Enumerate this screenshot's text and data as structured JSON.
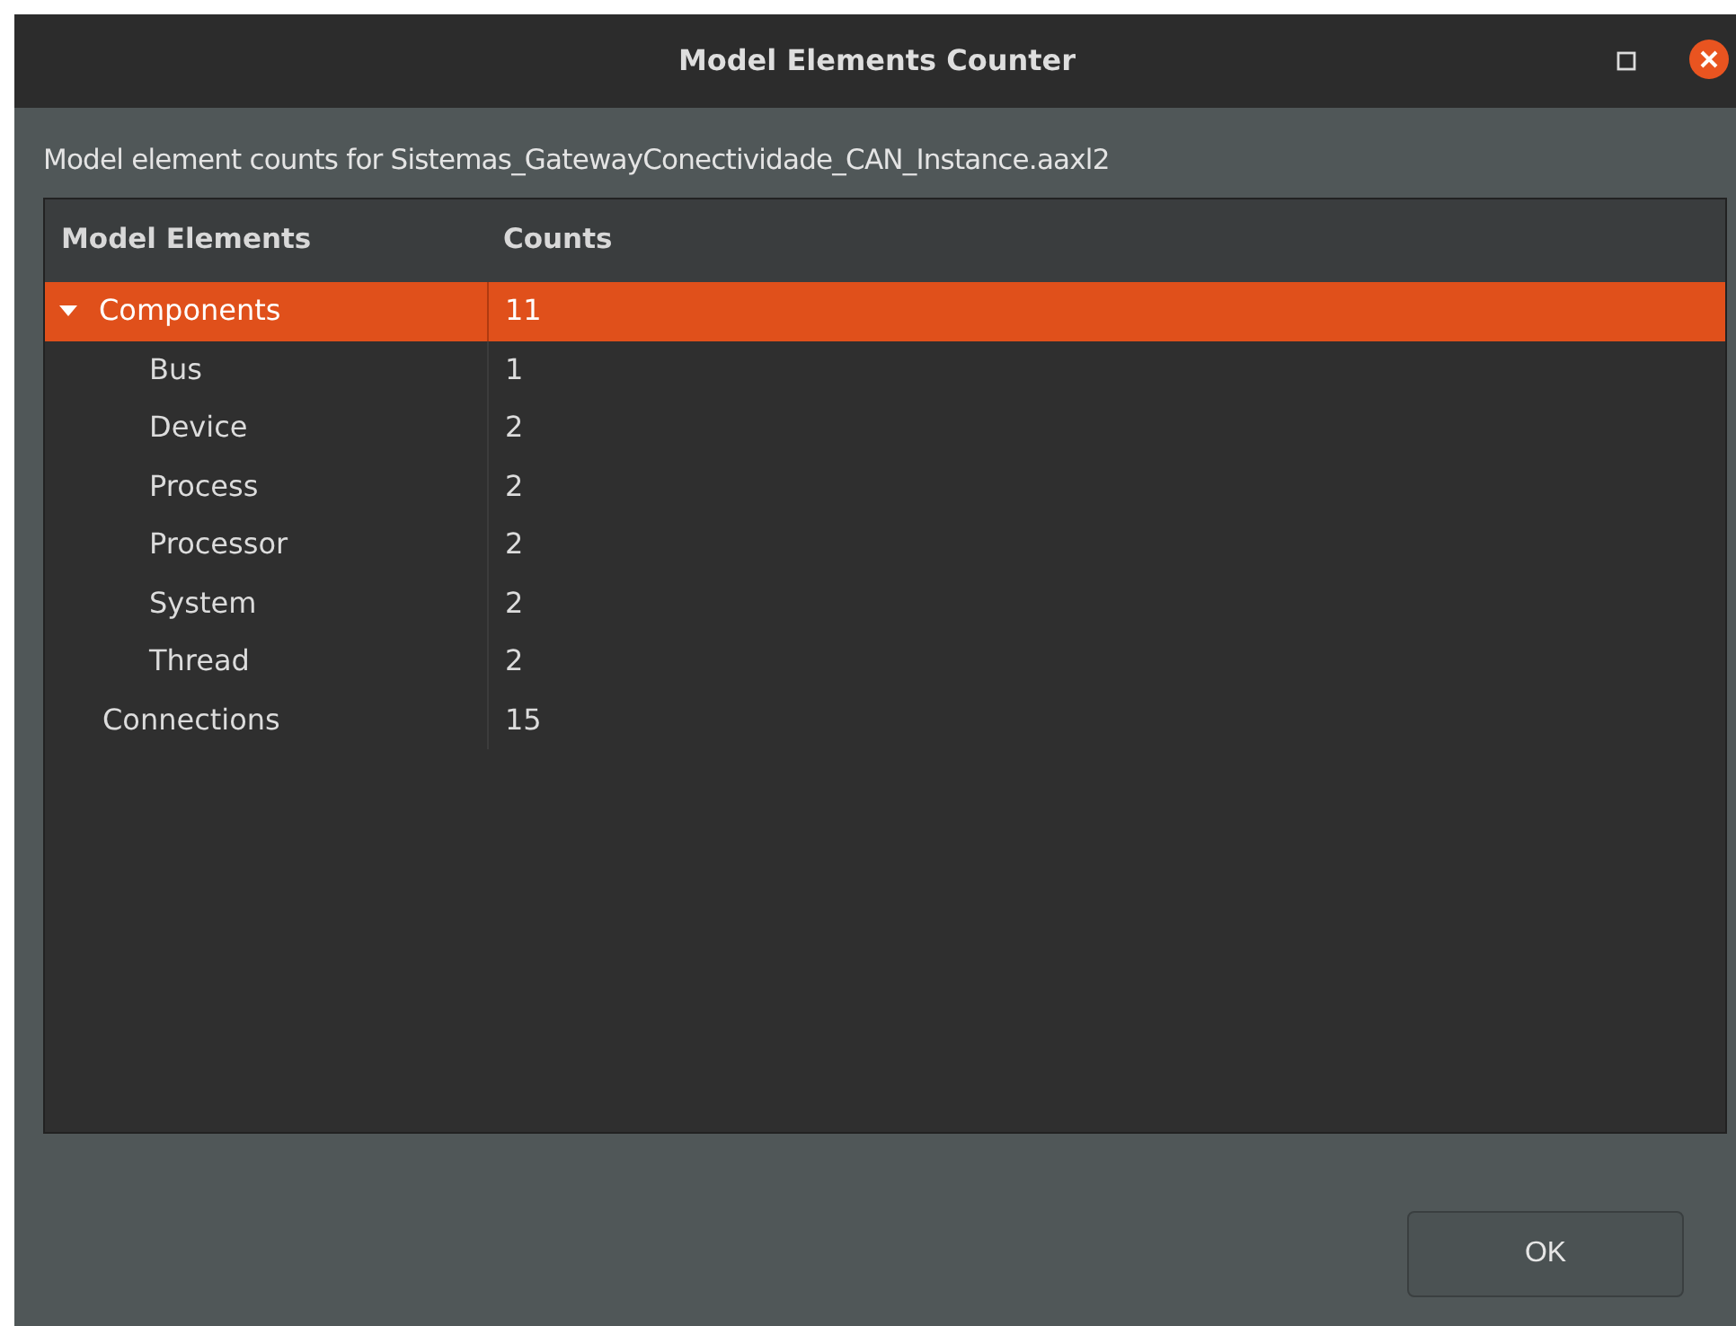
{
  "window": {
    "title": "Model Elements Counter"
  },
  "description": "Model element counts for Sistemas_GatewayConectividade_CAN_Instance.aaxl2",
  "table": {
    "columns": [
      "Model Elements",
      "Counts"
    ],
    "rows": [
      {
        "label": "Components",
        "count": "11",
        "selected": true,
        "expanded": true,
        "children": [
          {
            "label": "Bus",
            "count": "1",
            "selected": false
          },
          {
            "label": "Device",
            "count": "2",
            "selected": false
          },
          {
            "label": "Process",
            "count": "2",
            "selected": false
          },
          {
            "label": "Processor",
            "count": "2",
            "selected": false
          },
          {
            "label": "System",
            "count": "2",
            "selected": false
          },
          {
            "label": "Thread",
            "count": "2",
            "selected": false
          }
        ]
      },
      {
        "label": "Connections",
        "count": "15",
        "selected": false
      }
    ]
  },
  "buttons": [
    "OK"
  ]
}
